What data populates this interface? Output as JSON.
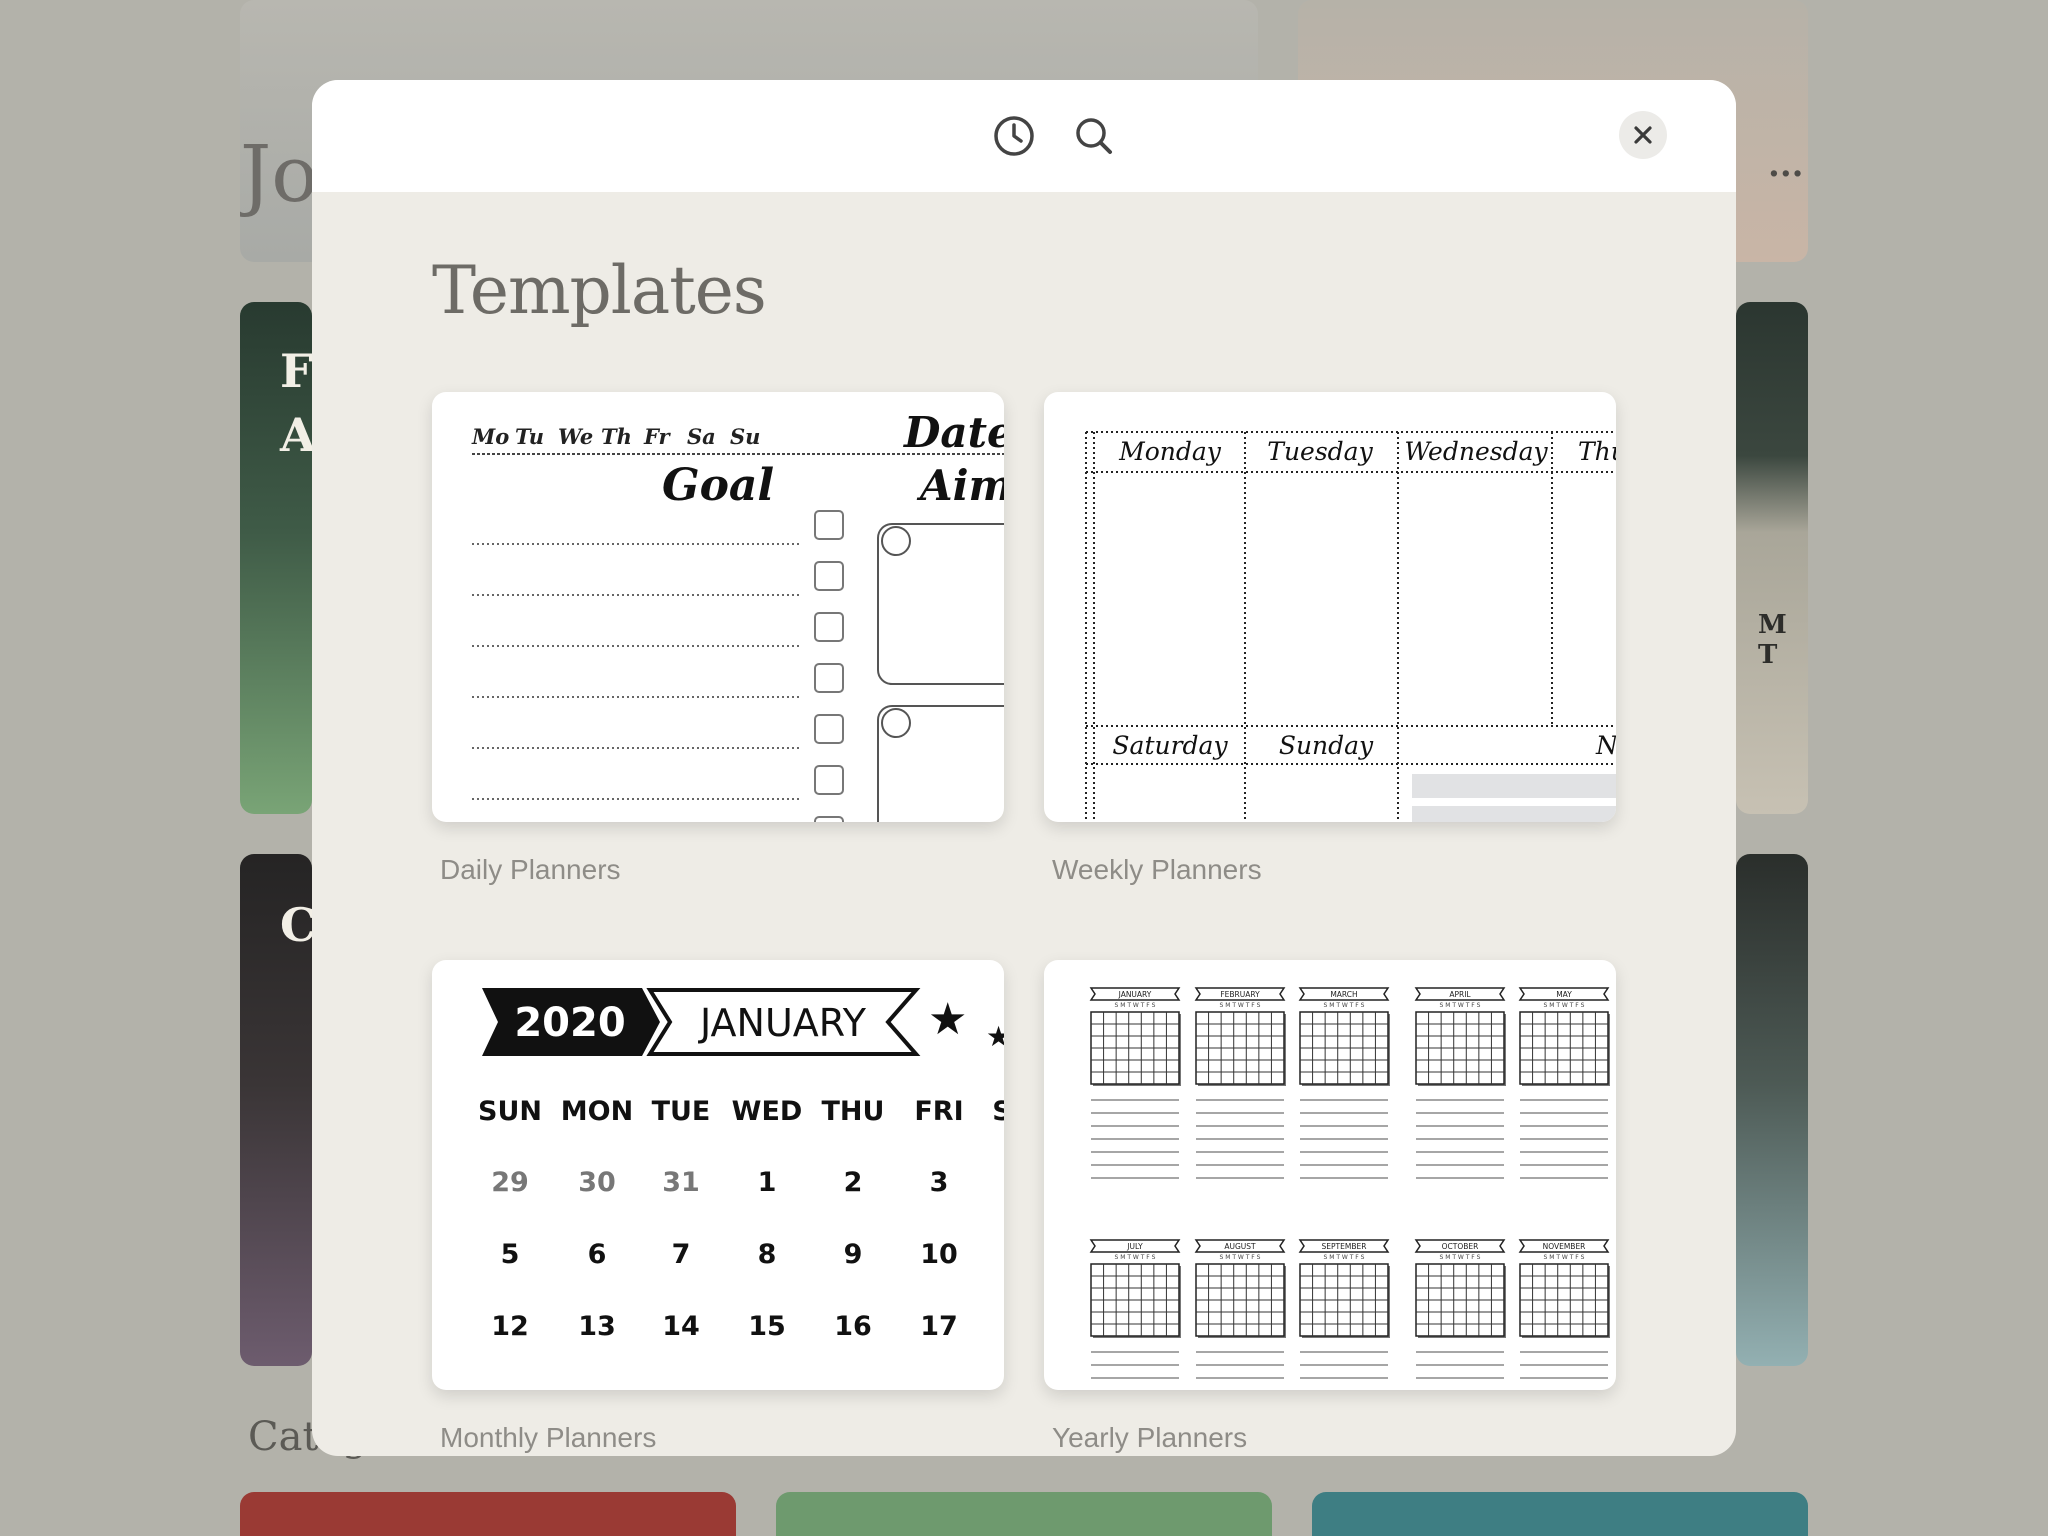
{
  "background": {
    "card_texts": [
      "Jo",
      "Fa",
      "A",
      "C",
      "Categ",
      "M T",
      "..."
    ]
  },
  "toolbar": {
    "recent_icon": "clock-icon",
    "search_icon": "search-icon",
    "close_icon": "close-icon"
  },
  "heading": "Templates",
  "templates": [
    {
      "label": "Daily Planners"
    },
    {
      "label": "Weekly Planners"
    },
    {
      "label": "Monthly Planners"
    },
    {
      "label": "Yearly Planners"
    }
  ],
  "daily_preview": {
    "days": [
      "Mo",
      "Tu",
      "We",
      "Th",
      "Fr",
      "Sa",
      "Su"
    ],
    "date_label": "Date",
    "goal_label": "Goal",
    "aim_label": "Aim"
  },
  "weekly_preview": {
    "top_days": [
      "Monday",
      "Tuesday",
      "Wednesday",
      "Thu"
    ],
    "bottom_days": [
      "Saturday",
      "Sunday",
      "N"
    ]
  },
  "monthly_preview": {
    "year": "2020",
    "month": "JANUARY",
    "weekdays": [
      "SUN",
      "MON",
      "TUE",
      "WED",
      "THU",
      "FRI",
      "S"
    ],
    "weeks": [
      [
        "29",
        "30",
        "31",
        "1",
        "2",
        "3"
      ],
      [
        "5",
        "6",
        "7",
        "8",
        "9",
        "10"
      ],
      [
        "12",
        "13",
        "14",
        "15",
        "16",
        "17"
      ]
    ]
  },
  "yearly_preview": {
    "months_top": [
      "JANUARY",
      "FEBRUARY",
      "MARCH",
      "APRIL",
      "MAY"
    ],
    "months_bottom": [
      "JULY",
      "AUGUST",
      "SEPTEMBER",
      "OCTOBER",
      "NOVEMBER"
    ],
    "weekday_initials": "S M T W T F S"
  }
}
